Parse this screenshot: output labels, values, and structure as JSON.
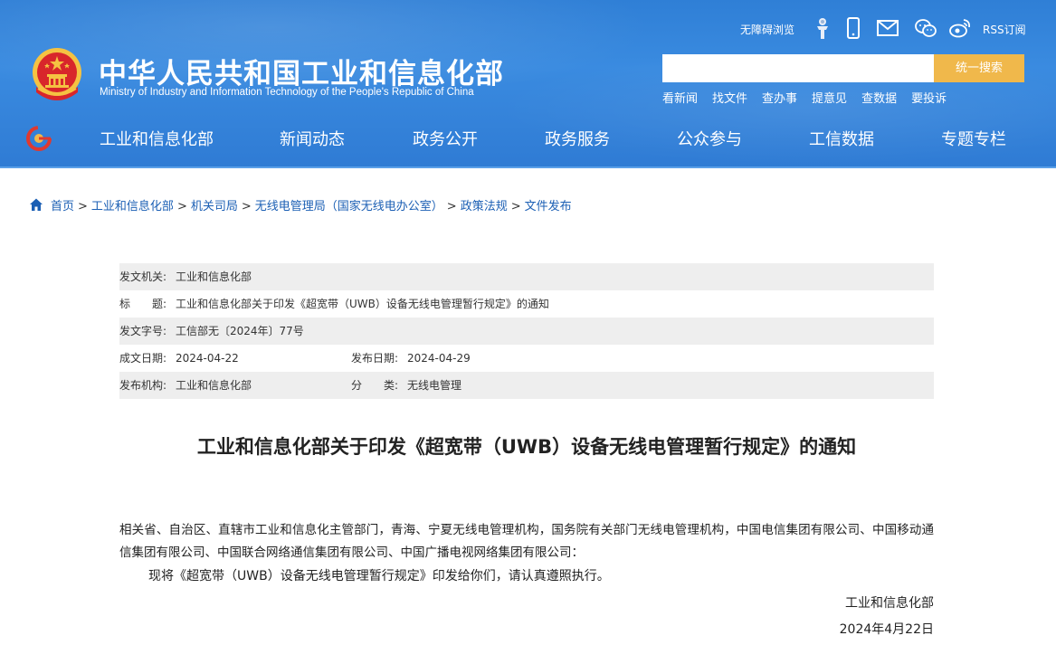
{
  "header": {
    "title_cn": "中华人民共和国工业和信息化部",
    "title_en": "Ministry of Industry and Information Technology of the People's Republic of China",
    "accessibility_label": "无障碍浏览",
    "rss_label": "RSS订阅",
    "icons": [
      "accessibility-person-icon",
      "mobile-phone-icon",
      "mail-icon",
      "wechat-icon",
      "weibo-icon"
    ],
    "search": {
      "value": "",
      "placeholder": "",
      "button_label": "统一搜索"
    },
    "quick_links": [
      "看新闻",
      "找文件",
      "查办事",
      "提意见",
      "查数据",
      "要投诉"
    ],
    "nav": [
      "工业和信息化部",
      "新闻动态",
      "政务公开",
      "政务服务",
      "公众参与",
      "工信数据",
      "专题专栏"
    ]
  },
  "breadcrumb": [
    "首页",
    "工业和信息化部",
    "机关司局",
    "无线电管理局（国家无线电办公室）",
    "政策法规",
    "文件发布"
  ],
  "info": {
    "issuer_label": "发文机关:",
    "issuer_value": "工业和信息化部",
    "title_label": "标　　题:",
    "title_value": "工业和信息化部关于印发《超宽带（UWB）设备无线电管理暂行规定》的通知",
    "doc_no_label": "发文字号:",
    "doc_no_value": "工信部无〔2024年〕77号",
    "created_label": "成文日期:",
    "created_value": "2024-04-22",
    "published_label": "发布日期:",
    "published_value": "2024-04-29",
    "agency_label": "发布机构:",
    "agency_value": "工业和信息化部",
    "category_label": "分　　类:",
    "category_value": "无线电管理"
  },
  "article": {
    "title": "工业和信息化部关于印发《超宽带（UWB）设备无线电管理暂行规定》的通知",
    "recipients": "相关省、自治区、直辖市工业和信息化主管部门，青海、宁夏无线电管理机构，国务院有关部门无线电管理机构，中国电信集团有限公司、中国移动通信集团有限公司、中国联合网络通信集团有限公司、中国广播电视网络集团有限公司：",
    "body": "现将《超宽带（UWB）设备无线电管理暂行规定》印发给你们，请认真遵照执行。",
    "signature": "工业和信息化部",
    "date": "2024年4月22日"
  },
  "colors": {
    "header_blue": "#2f7fd6",
    "search_button": "#f0b84b",
    "link_blue": "#1b5fb4",
    "table_gray": "#eeeeee"
  }
}
